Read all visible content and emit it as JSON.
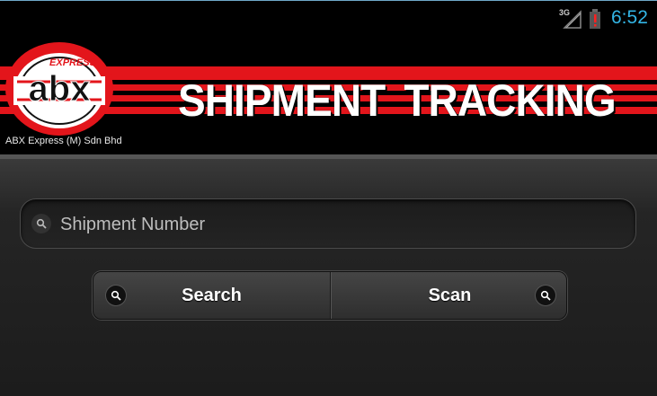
{
  "status_bar": {
    "network": "3G",
    "time": "6:52",
    "battery_alert": "!",
    "icons": [
      "signal-3g-icon",
      "battery-alert-icon"
    ]
  },
  "banner": {
    "logo_top_text": "EXPRESS",
    "logo_main_text": "abx",
    "title": "SHIPMENT TRACKING",
    "company": "ABX Express (M) Sdn Bhd"
  },
  "search": {
    "placeholder": "Shipment Number",
    "value": ""
  },
  "buttons": {
    "search_label": "Search",
    "scan_label": "Scan"
  },
  "colors": {
    "brand_red": "#e3151b",
    "status_time": "#33b5e5",
    "background": "#222222"
  }
}
